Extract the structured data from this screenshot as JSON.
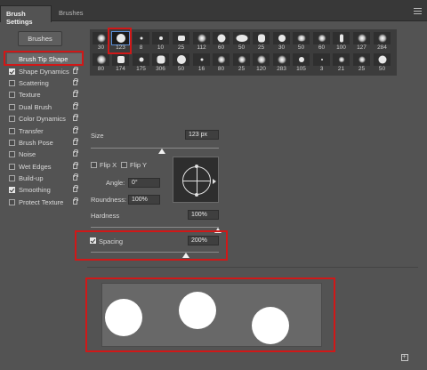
{
  "tabs": [
    {
      "label": "Brush Settings",
      "active": true
    },
    {
      "label": "Brushes",
      "active": false
    }
  ],
  "brushes_button": "Brushes",
  "options": [
    {
      "label": "Brush Tip Shape",
      "checkbox": false,
      "lock": false,
      "selected": true
    },
    {
      "label": "Shape Dynamics",
      "checkbox": true,
      "checked": true,
      "lock": true
    },
    {
      "label": "Scattering",
      "checkbox": true,
      "checked": false,
      "lock": true
    },
    {
      "label": "Texture",
      "checkbox": true,
      "checked": false,
      "lock": true
    },
    {
      "label": "Dual Brush",
      "checkbox": true,
      "checked": false,
      "lock": true
    },
    {
      "label": "Color Dynamics",
      "checkbox": true,
      "checked": false,
      "lock": true
    },
    {
      "label": "Transfer",
      "checkbox": true,
      "checked": false,
      "lock": true
    },
    {
      "label": "Brush Pose",
      "checkbox": true,
      "checked": false,
      "lock": true
    },
    {
      "label": "Noise",
      "checkbox": true,
      "checked": false,
      "lock": true
    },
    {
      "label": "Wet Edges",
      "checkbox": true,
      "checked": false,
      "lock": true
    },
    {
      "label": "Build-up",
      "checkbox": true,
      "checked": false,
      "lock": true
    },
    {
      "label": "Smoothing",
      "checkbox": true,
      "checked": true,
      "lock": true
    },
    {
      "label": "Protect Texture",
      "checkbox": true,
      "checked": false,
      "lock": true
    }
  ],
  "brush_presets_row1": [
    "30",
    "123",
    "8",
    "10",
    "25",
    "112",
    "60",
    "50",
    "25",
    "30",
    "50",
    "60",
    "100",
    "127",
    "284"
  ],
  "brush_presets_row2": [
    "80",
    "174",
    "175",
    "306",
    "50",
    "16",
    "80",
    "25",
    "120",
    "283",
    "105",
    "3",
    "21",
    "25",
    "50"
  ],
  "selected_preset": "123",
  "size": {
    "label": "Size",
    "value": "123 px"
  },
  "flip_x": {
    "label": "Flip X",
    "checked": false
  },
  "flip_y": {
    "label": "Flip Y",
    "checked": false
  },
  "angle": {
    "label": "Angle:",
    "value": "0°"
  },
  "roundness": {
    "label": "Roundness:",
    "value": "100%"
  },
  "hardness": {
    "label": "Hardness",
    "value": "100%"
  },
  "spacing": {
    "label": "Spacing",
    "value": "200%",
    "checked": true
  },
  "colors": {
    "highlight": "#d01818",
    "panel": "#535353",
    "accent": "#5a8fd8"
  }
}
